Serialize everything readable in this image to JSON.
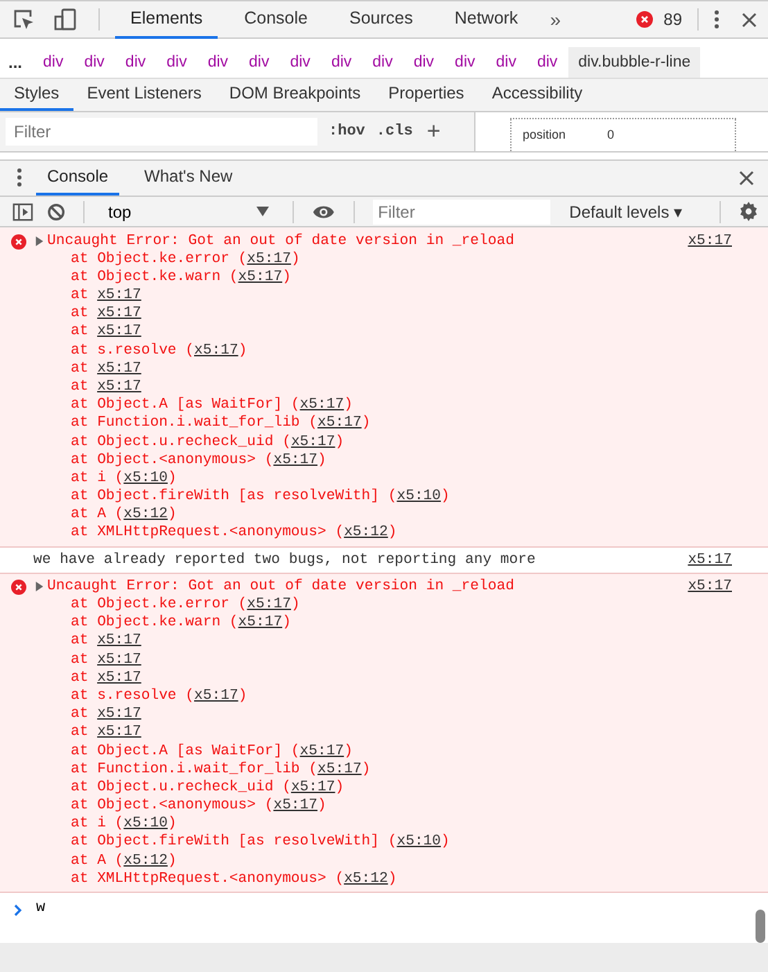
{
  "main_tabs": [
    {
      "label": "Elements",
      "selected": true
    },
    {
      "label": "Console",
      "selected": false
    },
    {
      "label": "Sources",
      "selected": false
    },
    {
      "label": "Network",
      "selected": false
    }
  ],
  "more_tabs": "»",
  "error_count": "89",
  "breadcrumb": {
    "ellipsis": "...",
    "items": [
      {
        "label": "div",
        "selected": false
      },
      {
        "label": "div",
        "selected": false
      },
      {
        "label": "div",
        "selected": false
      },
      {
        "label": "div",
        "selected": false
      },
      {
        "label": "div",
        "selected": false
      },
      {
        "label": "div",
        "selected": false
      },
      {
        "label": "div",
        "selected": false
      },
      {
        "label": "div",
        "selected": false
      },
      {
        "label": "div",
        "selected": false
      },
      {
        "label": "div",
        "selected": false
      },
      {
        "label": "div",
        "selected": false
      },
      {
        "label": "div",
        "selected": false
      },
      {
        "label": "div",
        "selected": false
      },
      {
        "label": "div.bubble-r-line",
        "selected": true
      }
    ]
  },
  "styles_tabs": [
    {
      "label": "Styles",
      "selected": true
    },
    {
      "label": "Event Listeners",
      "selected": false
    },
    {
      "label": "DOM Breakpoints",
      "selected": false
    },
    {
      "label": "Properties",
      "selected": false
    },
    {
      "label": "Accessibility",
      "selected": false
    }
  ],
  "styles_filter": {
    "placeholder": "Filter",
    "hov": ":hov",
    "cls": ".cls",
    "add": "+"
  },
  "box_model": {
    "label": "position",
    "value": "0"
  },
  "drawer_tabs": [
    {
      "label": "Console",
      "selected": true
    },
    {
      "label": "What's New",
      "selected": false
    }
  ],
  "console_toolbar": {
    "context": "top",
    "filter_placeholder": "Filter",
    "levels": "Default levels ▾"
  },
  "messages": [
    {
      "kind": "error",
      "expanded": false,
      "text": "Uncaught Error: Got an out of date version in _reload",
      "source": "x5:17",
      "frames": [
        {
          "pre": "at Object.ke.error (",
          "link": "x5:17",
          "post": ")"
        },
        {
          "pre": "at Object.ke.warn (",
          "link": "x5:17",
          "post": ")"
        },
        {
          "pre": "at ",
          "link": "x5:17"
        },
        {
          "pre": "at ",
          "link": "x5:17"
        },
        {
          "pre": "at ",
          "link": "x5:17"
        },
        {
          "pre": "at s.resolve (",
          "link": "x5:17",
          "post": ")"
        },
        {
          "pre": "at ",
          "link": "x5:17"
        },
        {
          "pre": "at ",
          "link": "x5:17"
        },
        {
          "pre": "at Object.A [as WaitFor] (",
          "link": "x5:17",
          "post": ")"
        },
        {
          "pre": "at Function.i.wait_for_lib (",
          "link": "x5:17",
          "post": ")"
        },
        {
          "pre": "at Object.u.recheck_uid (",
          "link": "x5:17",
          "post": ")"
        },
        {
          "pre": "at Object.<anonymous> (",
          "link": "x5:17",
          "post": ")"
        },
        {
          "pre": "at i (",
          "link": "x5:10",
          "post": ")"
        },
        {
          "pre": "at Object.fireWith [as resolveWith] (",
          "link": "x5:10",
          "post": ")"
        },
        {
          "pre": "at A (",
          "link": "x5:12",
          "post": ")"
        },
        {
          "pre": "at XMLHttpRequest.<anonymous> (",
          "link": "x5:12",
          "post": ")"
        }
      ]
    },
    {
      "kind": "log",
      "text": "we have already reported two bugs, not reporting any more",
      "source": "x5:17"
    },
    {
      "kind": "error",
      "expanded": false,
      "text": "Uncaught Error: Got an out of date version in _reload",
      "source": "x5:17",
      "frames": [
        {
          "pre": "at Object.ke.error (",
          "link": "x5:17",
          "post": ")"
        },
        {
          "pre": "at Object.ke.warn (",
          "link": "x5:17",
          "post": ")"
        },
        {
          "pre": "at ",
          "link": "x5:17"
        },
        {
          "pre": "at ",
          "link": "x5:17"
        },
        {
          "pre": "at ",
          "link": "x5:17"
        },
        {
          "pre": "at s.resolve (",
          "link": "x5:17",
          "post": ")"
        },
        {
          "pre": "at ",
          "link": "x5:17"
        },
        {
          "pre": "at ",
          "link": "x5:17"
        },
        {
          "pre": "at Object.A [as WaitFor] (",
          "link": "x5:17",
          "post": ")"
        },
        {
          "pre": "at Function.i.wait_for_lib (",
          "link": "x5:17",
          "post": ")"
        },
        {
          "pre": "at Object.u.recheck_uid (",
          "link": "x5:17",
          "post": ")"
        },
        {
          "pre": "at Object.<anonymous> (",
          "link": "x5:17",
          "post": ")"
        },
        {
          "pre": "at i (",
          "link": "x5:10",
          "post": ")"
        },
        {
          "pre": "at Object.fireWith [as resolveWith] (",
          "link": "x5:10",
          "post": ")"
        },
        {
          "pre": "at A (",
          "link": "x5:12",
          "post": ")"
        },
        {
          "pre": "at XMLHttpRequest.<anonymous> (",
          "link": "x5:12",
          "post": ")"
        }
      ]
    }
  ],
  "prompt": {
    "value": "w"
  }
}
